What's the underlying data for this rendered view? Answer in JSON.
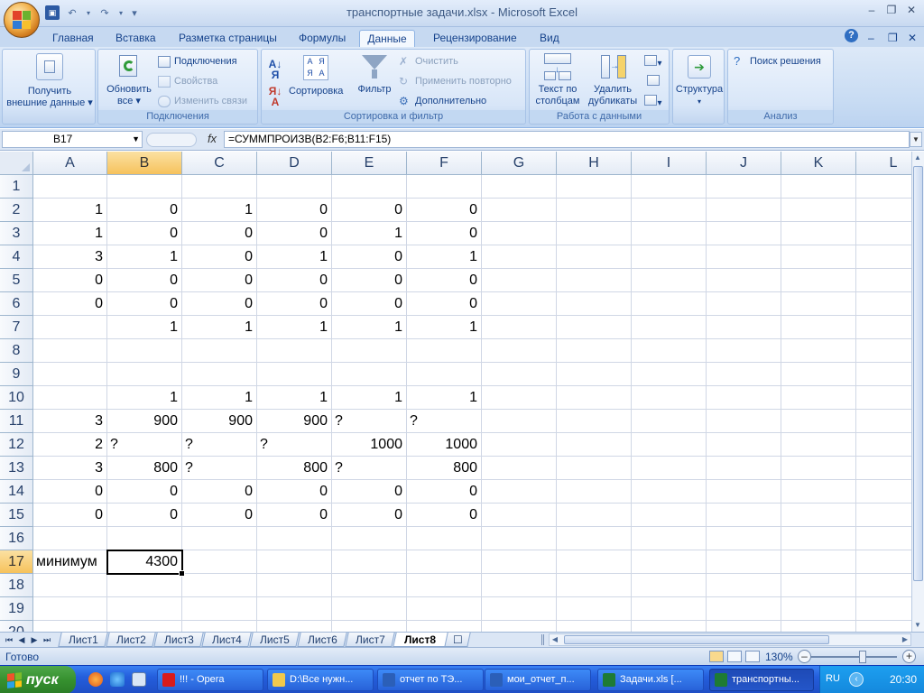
{
  "window": {
    "title": "транспортные задачи.xlsx - Microsoft Excel",
    "minimize": "–",
    "restore": "❐",
    "close": "✕"
  },
  "qat": {
    "save": "💾",
    "undo": "↶",
    "redo": "↷",
    "customize": "▾"
  },
  "ribbon_tabs": [
    "Главная",
    "Вставка",
    "Разметка страницы",
    "Формулы",
    "Данные",
    "Рецензирование",
    "Вид"
  ],
  "active_tab": "Данные",
  "ribbon": {
    "get_external": {
      "line1": "Получить",
      "line2": "внешние данные"
    },
    "connections_group": {
      "label": "Подключения",
      "refresh": {
        "line1": "Обновить",
        "line2": "все"
      },
      "connections": "Подключения",
      "properties": "Свойства",
      "edit_links": "Изменить связи"
    },
    "sort_filter_group": {
      "label": "Сортировка и фильтр",
      "sort": "Сортировка",
      "filter": "Фильтр",
      "clear": "Очистить",
      "reapply": "Применить повторно",
      "advanced": "Дополнительно"
    },
    "data_tools_group": {
      "label": "Работа с данными",
      "text_to_columns": {
        "line1": "Текст по",
        "line2": "столбцам"
      },
      "remove_duplicates": {
        "line1": "Удалить",
        "line2": "дубликаты"
      }
    },
    "outline": {
      "label": "Структура"
    },
    "analysis_group": {
      "label": "Анализ",
      "solver": "Поиск решения"
    }
  },
  "formula_bar": {
    "name_box": "B17",
    "fx": "fx",
    "formula": "=СУММПРОИЗВ(B2:F6;B11:F15)"
  },
  "columns": [
    "A",
    "B",
    "C",
    "D",
    "E",
    "F",
    "G",
    "H",
    "I",
    "J",
    "K",
    "L"
  ],
  "rows": [
    "1",
    "2",
    "3",
    "4",
    "5",
    "6",
    "7",
    "8",
    "9",
    "10",
    "11",
    "12",
    "13",
    "14",
    "15",
    "16",
    "17",
    "18",
    "19",
    "20"
  ],
  "cells": [
    [],
    [
      "1",
      "0",
      "1",
      "0",
      "0",
      "0"
    ],
    [
      "1",
      "0",
      "0",
      "0",
      "1",
      "0"
    ],
    [
      "3",
      "1",
      "0",
      "1",
      "0",
      "1"
    ],
    [
      "0",
      "0",
      "0",
      "0",
      "0",
      "0"
    ],
    [
      "0",
      "0",
      "0",
      "0",
      "0",
      "0"
    ],
    [
      "",
      "1",
      "1",
      "1",
      "1",
      "1"
    ],
    [],
    [],
    [
      "",
      "1",
      "1",
      "1",
      "1",
      "1"
    ],
    [
      "3",
      "900",
      "900",
      "900",
      "?",
      "?"
    ],
    [
      "2",
      "?",
      "?",
      "?",
      "1000",
      "1000"
    ],
    [
      "3",
      "800",
      "?",
      "800",
      "?",
      "800"
    ],
    [
      "0",
      "0",
      "0",
      "0",
      "0",
      "0"
    ],
    [
      "0",
      "0",
      "0",
      "0",
      "0",
      "0"
    ],
    [],
    [
      "минимум",
      "4300"
    ],
    [],
    [],
    []
  ],
  "selected_cell": "B17",
  "sheets": [
    "Лист1",
    "Лист2",
    "Лист3",
    "Лист4",
    "Лист5",
    "Лист6",
    "Лист7",
    "Лист8"
  ],
  "active_sheet": "Лист8",
  "status": {
    "text": "Готово",
    "zoom": "130%"
  },
  "taskbar": {
    "start": "пуск",
    "tasks": [
      {
        "label": "!!! - Opera",
        "color": "#d81c1c"
      },
      {
        "label": "D:\\Все нужн...",
        "color": "#f2c94c"
      },
      {
        "label": "отчет по ТЭ...",
        "color": "#2b5fb8"
      },
      {
        "label": "мои_отчет_п...",
        "color": "#2b5fb8"
      },
      {
        "label": "Задачи.xls [...",
        "color": "#1e7b34"
      },
      {
        "label": "транспортны...",
        "color": "#1e7b34",
        "active": true
      }
    ],
    "lang": "RU",
    "clock": "20:30"
  }
}
